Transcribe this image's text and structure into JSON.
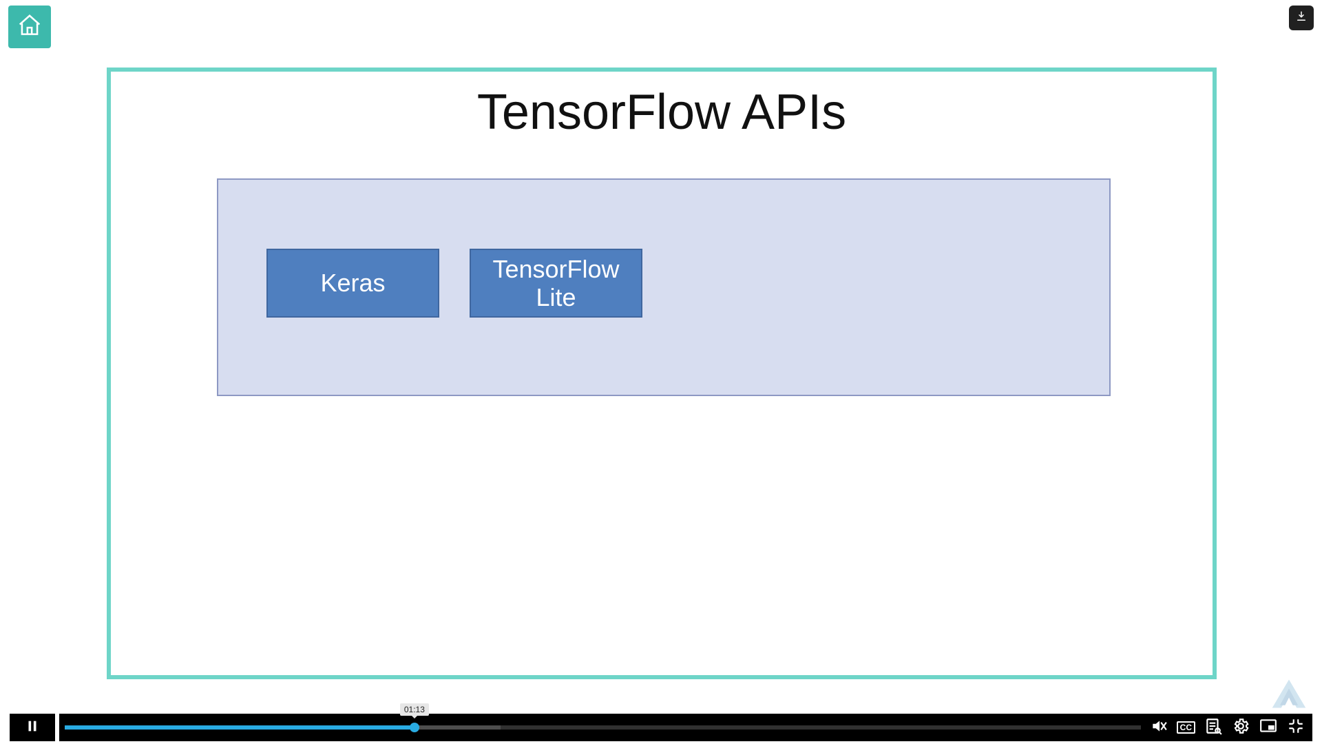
{
  "slide": {
    "title": "TensorFlow APIs",
    "api_boxes": [
      "Keras",
      "TensorFlow\nLite"
    ]
  },
  "player": {
    "tooltip_time": "01:13",
    "progress_pct": 32.5,
    "buffer_pct": 40.5,
    "cc_label": "CC"
  },
  "icons": {
    "home": "home-icon",
    "download": "download-icon",
    "pause": "pause-icon",
    "volume": "volume-icon",
    "transcript": "transcript-icon",
    "settings": "gear-icon",
    "pip": "pip-icon",
    "fullscreen_exit": "fullscreen-exit-icon"
  }
}
